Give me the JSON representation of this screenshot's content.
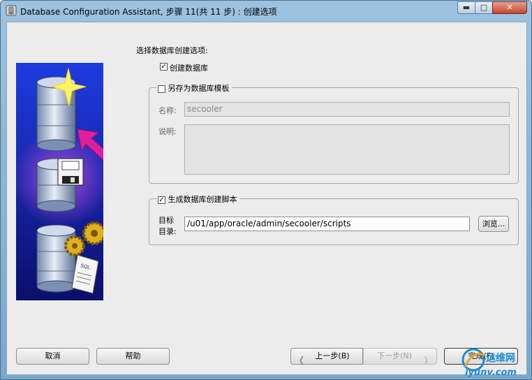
{
  "window": {
    "title": "Database Configuration Assistant, 步骤 11(共 11 步) : 创建选项"
  },
  "content": {
    "prompt": "选择数据库创建选项:",
    "create_db_label": "创建数据库",
    "create_db_checked": true,
    "save_template": {
      "legend": "另存为数据库模板",
      "checked": false,
      "name_label": "名称:",
      "name_value": "secooler",
      "desc_label": "说明:",
      "desc_value": ""
    },
    "gen_scripts": {
      "legend": "生成数据库创建脚本",
      "checked": true,
      "target_label_1": "目标",
      "target_label_2": "目录:",
      "target_value": "/u01/app/oracle/admin/secooler/scripts",
      "browse_label": "浏览..."
    }
  },
  "footer": {
    "cancel_label": "取消",
    "help_label": "帮助",
    "back_label": "上一步(B)",
    "next_label": "下一步(N)",
    "finish_label": "完成(F)"
  },
  "watermark": {
    "text_top": "运维网",
    "text_bottom": "iyunv.com"
  },
  "colors": {
    "hero_top": "#1d3ce0",
    "hero_bottom": "#0a0f6a",
    "arrow": "#e0209a",
    "watermark": "#1a8ad6"
  }
}
